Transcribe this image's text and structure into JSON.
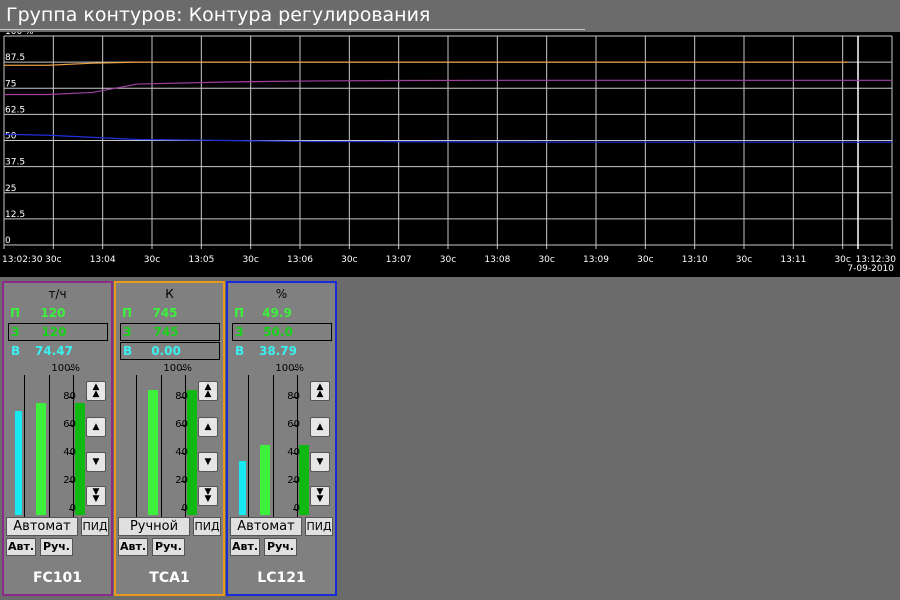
{
  "window": {
    "title": "Группа контуров: Контура регулирования"
  },
  "trend": {
    "y_ticks": [
      "100 %",
      "87.5",
      "75",
      "62.5",
      "50",
      "37.5",
      "25",
      "12.5",
      "0"
    ],
    "x_ticks": [
      "13:02:30",
      "30c",
      "13:04",
      "30c",
      "13:05",
      "30c",
      "13:06",
      "30c",
      "13:07",
      "30c",
      "13:08",
      "30c",
      "13:09",
      "30c",
      "13:10",
      "30c",
      "13:11",
      "30c",
      "13:12:30"
    ],
    "date": "7-09-2010",
    "colors": {
      "background": "#000000",
      "grid": "#c8c8c8",
      "series1": "#e8a040",
      "series2": "#a040a0",
      "series3": "#2030e0"
    }
  },
  "chart_data": {
    "type": "line",
    "ylim": [
      0,
      100
    ],
    "x": [
      "13:02:30",
      "13:03:00",
      "13:03:30",
      "13:04:00",
      "13:05:00",
      "13:06:00",
      "13:07:00",
      "13:08:00",
      "13:09:00",
      "13:10:00",
      "13:11:00",
      "13:12:00",
      "13:12:30"
    ],
    "series": [
      {
        "values": [
          86,
          86,
          87,
          87.5,
          87.5,
          87.5,
          87.5,
          87.5,
          87.5,
          87.5,
          87.5,
          87.5,
          null
        ]
      },
      {
        "values": [
          72,
          72,
          73,
          77,
          78,
          78.5,
          78.7,
          78.8,
          78.8,
          78.8,
          78.8,
          78.8,
          78.8
        ]
      },
      {
        "values": [
          53,
          52.5,
          51.5,
          50.5,
          50,
          49.5,
          49.4,
          49.3,
          49.2,
          49.2,
          49.2,
          49.2,
          49.2
        ]
      }
    ],
    "grid": true
  },
  "loops": [
    {
      "tag": "FC101",
      "unit": "т/ч",
      "p_label": "П",
      "p_value": "120",
      "z_label": "З",
      "z_value": "120",
      "v_label": "В",
      "v_value": "74.47",
      "scale": [
        "100%",
        "80",
        "60",
        "40",
        "20",
        "0"
      ],
      "out_level": 74.47,
      "sp_level": 80,
      "pv_level": 80,
      "mode": "Автомат",
      "pid": "ПИД",
      "auto": "Авт.",
      "manual": "Руч.",
      "border_color": "#8a2a8a"
    },
    {
      "tag": "TCA1",
      "unit": "К",
      "p_label": "П",
      "p_value": "745",
      "z_label": "З",
      "z_value": "745",
      "v_label": "В",
      "v_value": "0.00",
      "scale": [
        "100%",
        "80",
        "60",
        "40",
        "20",
        "0"
      ],
      "out_level": 0,
      "sp_level": 89,
      "pv_level": 89,
      "mode": "Ручной",
      "pid": "ПИД",
      "auto": "Авт.",
      "manual": "Руч.",
      "border_color": "#e89a1a"
    },
    {
      "tag": "LC121",
      "unit": "%",
      "p_label": "П",
      "p_value": "49.9",
      "z_label": "З",
      "z_value": "50.0",
      "v_label": "В",
      "v_value": "38.79",
      "scale": [
        "100%",
        "80",
        "60",
        "40",
        "20",
        "0"
      ],
      "out_level": 38.79,
      "sp_level": 50,
      "pv_level": 50,
      "mode": "Автомат",
      "pid": "ПИД",
      "auto": "Авт.",
      "manual": "Руч.",
      "border_color": "#1a2ad8"
    }
  ]
}
